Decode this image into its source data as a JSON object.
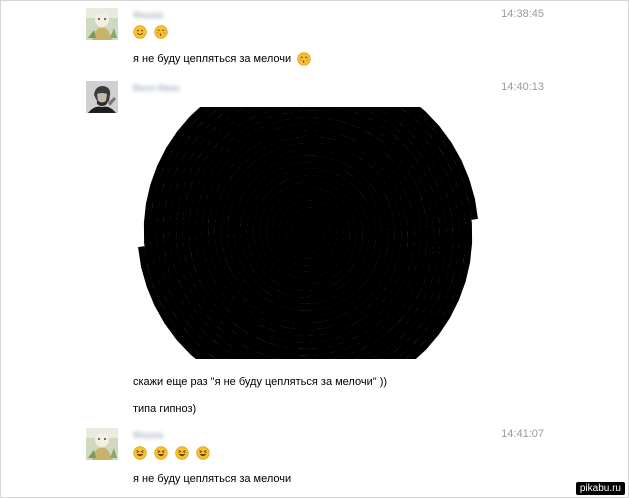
{
  "messages": [
    {
      "author": "Ф&#1080;ш&#1082;а",
      "time": "14:38:45",
      "emoji_line": [
        "smiling-face",
        "kissing-face"
      ],
      "text": "я не буду цепляться за мелочи",
      "text_emoji": "kissing-face"
    },
    {
      "author": "Вася Иван",
      "time": "14:40:13",
      "lines": [
        "скажи еще раз \"я не буду цепляться за мелочи\" ))",
        "типа гипноз)"
      ]
    },
    {
      "author": "Ф&#1080;ш&#1082;а",
      "time": "14:41:07",
      "emoji_line": [
        "laughing-face",
        "laughing-face",
        "laughing-face",
        "laughing-face"
      ],
      "text": "я не буду цепляться за мелочи"
    }
  ],
  "watermark": "pikabu.ru",
  "colors": {
    "time": "#999999",
    "author_blurred": "#a9b4c2",
    "emoji_face": "#f7c232",
    "emoji_border": "#e0a417"
  }
}
